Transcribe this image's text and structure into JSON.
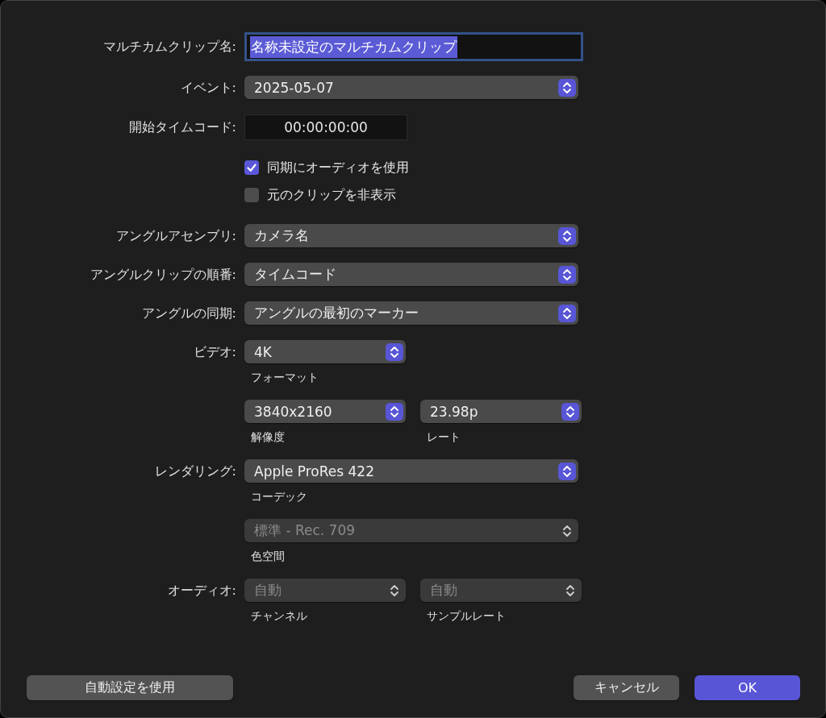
{
  "rows": [
    {
      "kind": "text_field",
      "label": "マルチカムクリップ名:",
      "value": "名称未設定のマルチカムクリップ",
      "focused": true,
      "text_selected": true
    },
    {
      "kind": "popup_group",
      "label": "イベント:",
      "popups": [
        {
          "value": "2025-05-07",
          "kind": "full",
          "disabled": false
        }
      ]
    },
    {
      "kind": "timecode",
      "label": "開始タイムコード:",
      "value": "00:00:00:00"
    },
    {
      "kind": "checkbox",
      "text": "同期にオーディオを使用",
      "checked": true
    },
    {
      "kind": "checkbox",
      "text": "元のクリップを非表示",
      "checked": false
    },
    {
      "kind": "popup_group",
      "label": "アングルアセンブリ:",
      "popups": [
        {
          "value": "カメラ名",
          "kind": "full",
          "disabled": false
        }
      ]
    },
    {
      "kind": "popup_group",
      "label": "アングルクリップの順番:",
      "popups": [
        {
          "value": "タイムコード",
          "kind": "full",
          "disabled": false
        }
      ]
    },
    {
      "kind": "popup_group",
      "label": "アングルの同期:",
      "popups": [
        {
          "value": "アングルの最初のマーカー",
          "kind": "full",
          "disabled": false
        }
      ]
    },
    {
      "kind": "popup_group",
      "label": "ビデオ:",
      "popups": [
        {
          "value": "4K",
          "caption": "フォーマット",
          "kind": "half",
          "disabled": false
        }
      ]
    },
    {
      "kind": "popup_group",
      "popups": [
        {
          "value": "3840x2160",
          "caption": "解像度",
          "kind": "half",
          "disabled": false
        },
        {
          "value": "23.98p",
          "caption": "レート",
          "kind": "half",
          "disabled": false
        }
      ]
    },
    {
      "kind": "popup_group",
      "label": "レンダリング:",
      "popups": [
        {
          "value": "Apple ProRes 422",
          "caption": "コーデック",
          "kind": "full",
          "disabled": false
        }
      ]
    },
    {
      "kind": "popup_group",
      "popups": [
        {
          "value": "標準 - Rec. 709",
          "caption": "色空間",
          "kind": "full",
          "disabled": true
        }
      ]
    },
    {
      "kind": "popup_group",
      "label": "オーディオ:",
      "popups": [
        {
          "value": "自動",
          "caption": "チャンネル",
          "kind": "half",
          "disabled": true
        },
        {
          "value": "自動",
          "caption": "サンプルレート",
          "kind": "half",
          "disabled": true
        }
      ]
    }
  ],
  "footer": {
    "left_buttons": [
      {
        "label": "自動設定を使用",
        "default": false
      }
    ],
    "right_buttons": [
      {
        "label": "キャンセル",
        "default": false
      },
      {
        "label": "OK",
        "default": true
      }
    ]
  }
}
